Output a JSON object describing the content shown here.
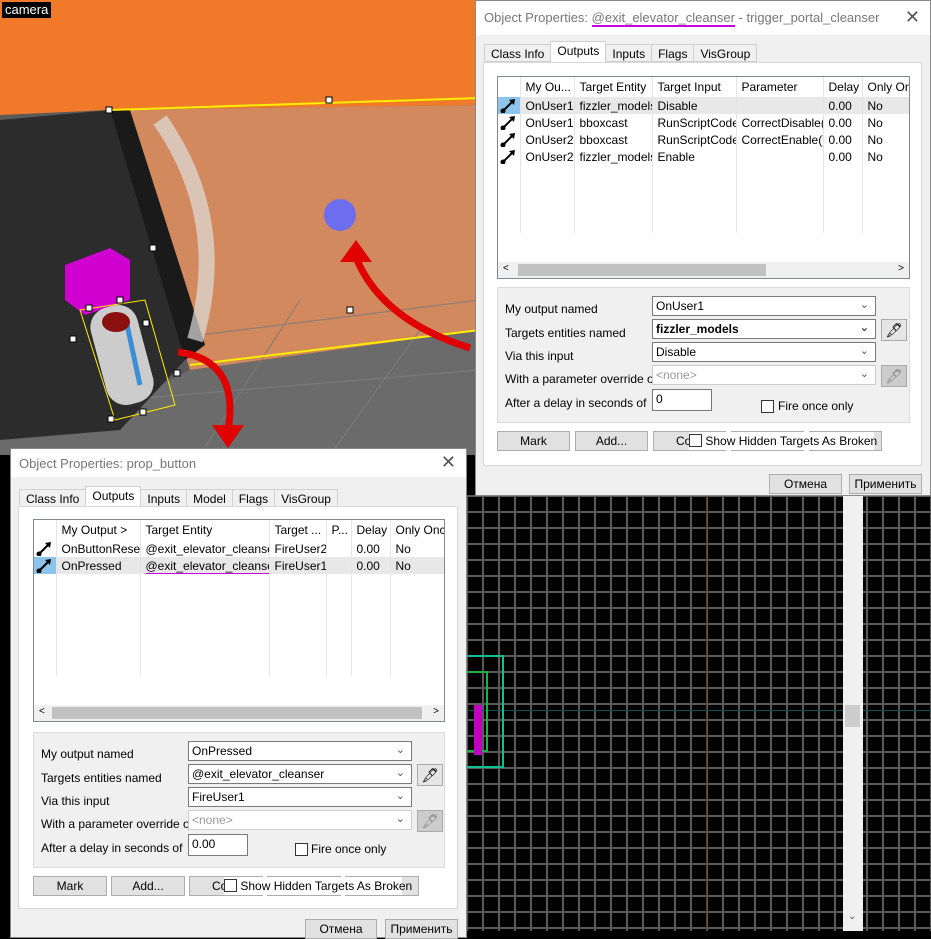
{
  "viewport3d": {
    "label": "camera"
  },
  "top_dialog": {
    "title_prefix": "Object Properties: ",
    "title_name": "@exit_elevator_cleanser",
    "title_suffix": " - trigger_portal_cleanser",
    "tabs": [
      "Class Info",
      "Outputs",
      "Inputs",
      "Flags",
      "VisGroup"
    ],
    "active_tab": "Outputs",
    "columns": [
      "My Ou...",
      "Target Entity",
      "Target Input",
      "Parameter",
      "Delay",
      "Only Onc"
    ],
    "rows": [
      {
        "output": "OnUser1",
        "target": "fizzler_models",
        "input": "Disable",
        "param": "",
        "delay": "0.00",
        "once": "No",
        "selected": true
      },
      {
        "output": "OnUser1",
        "target": "bboxcast",
        "input": "RunScriptCode",
        "param": "CorrectDisable()",
        "delay": "0.00",
        "once": "No"
      },
      {
        "output": "OnUser2",
        "target": "bboxcast",
        "input": "RunScriptCode",
        "param": "CorrectEnable()",
        "delay": "0.00",
        "once": "No"
      },
      {
        "output": "OnUser2",
        "target": "fizzler_models",
        "input": "Enable",
        "param": "",
        "delay": "0.00",
        "once": "No"
      }
    ],
    "form": {
      "output_label": "My output named",
      "output_value": "OnUser1",
      "target_label": "Targets entities named",
      "target_value": "fizzler_models",
      "input_label": "Via this input",
      "input_value": "Disable",
      "param_label": "With a parameter override of",
      "param_value": "<none>",
      "delay_label": "After a delay in seconds of",
      "delay_value": "0",
      "fire_once_label": "Fire once only",
      "fire_once": false
    },
    "buttons": {
      "mark": "Mark",
      "add": "Add...",
      "copy": "Co",
      "show_hidden": "Show Hidden Targets As Broken",
      "cancel": "Отмена",
      "apply": "Применить"
    }
  },
  "bottom_dialog": {
    "title": "Object Properties: prop_button",
    "tabs": [
      "Class Info",
      "Outputs",
      "Inputs",
      "Model",
      "Flags",
      "VisGroup"
    ],
    "active_tab": "Outputs",
    "columns": [
      "My Output  >",
      "Target Entity",
      "Target ...",
      "P...",
      "Delay",
      "Only Once"
    ],
    "rows": [
      {
        "output": "OnButtonReset",
        "target": "@exit_elevator_cleanser",
        "input": "FireUser2",
        "param": "",
        "delay": "0.00",
        "once": "No"
      },
      {
        "output": "OnPressed",
        "target": "@exit_elevator_cleanser",
        "input": "FireUser1",
        "param": "",
        "delay": "0.00",
        "once": "No",
        "selected": true
      }
    ],
    "form": {
      "output_label": "My output named",
      "output_value": "OnPressed",
      "target_label": "Targets entities named",
      "target_value": "@exit_elevator_cleanser",
      "input_label": "Via this input",
      "input_value": "FireUser1",
      "param_label": "With a parameter override of",
      "param_value": "<none>",
      "delay_label": "After a delay in seconds of",
      "delay_value": "0.00",
      "fire_once_label": "Fire once only",
      "fire_once": false
    },
    "buttons": {
      "mark": "Mark",
      "add": "Add...",
      "copy": "Co",
      "show_hidden": "Show Hidden Targets As Broken",
      "cancel": "Отмена",
      "apply": "Применить"
    }
  },
  "colors": {
    "highlight_underline": "#c800e0",
    "annotation_arrow": "#e00000",
    "wall": "#f07a2a",
    "selected_icon": "#8cc4ec"
  },
  "icons": {
    "close": "close-icon",
    "eyedropper": "eyedropper-icon",
    "output_connection": "connection-arrow-icon",
    "chevron": "chevron-down-icon"
  }
}
